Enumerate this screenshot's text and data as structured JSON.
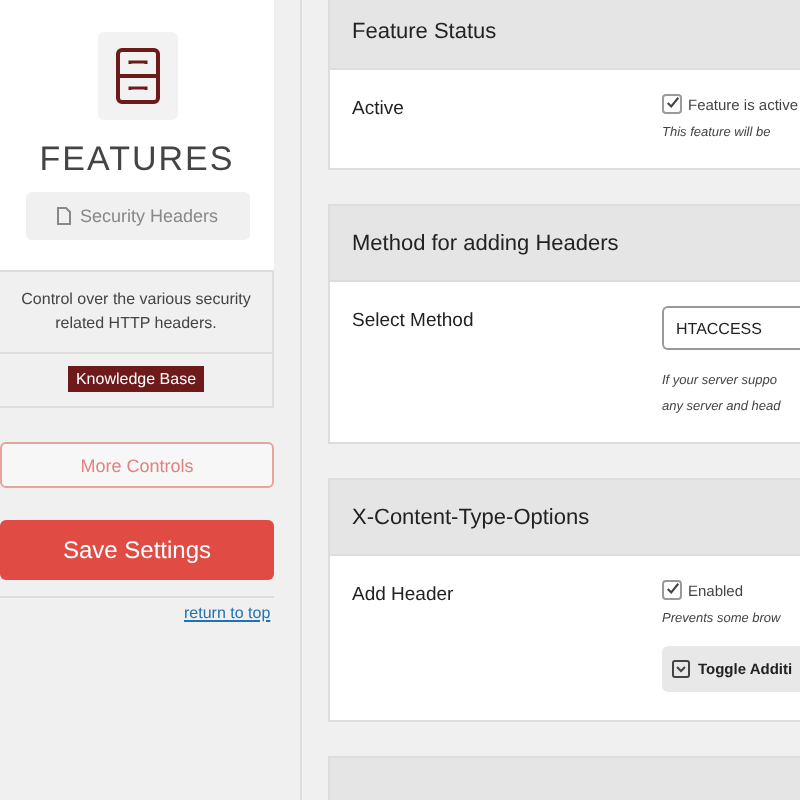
{
  "sidebar": {
    "title": "FEATURES",
    "feature_pill": "Security Headers",
    "description": "Control over the various security related HTTP headers.",
    "kb_badge": "Knowledge Base",
    "more_button": "More Controls",
    "save_button": "Save Settings",
    "top_link": "return to top"
  },
  "cards": [
    {
      "kind": "section",
      "title": "Feature Status",
      "rows": [
        {
          "label": "Active",
          "kind": "checkbox",
          "text": "Feature is active",
          "checked": true,
          "notes": [
            "This feature will be"
          ]
        }
      ]
    },
    {
      "kind": "section",
      "title": "Method for adding Headers",
      "rows": [
        {
          "label": "Select Method",
          "kind": "select",
          "text": "HTACCESS",
          "notes": [
            "If your server suppo",
            "any server and head"
          ]
        }
      ]
    },
    {
      "kind": "section",
      "title": "X-Content-Type-Options",
      "rows": [
        {
          "label": "Add Header",
          "kind": "checkbox",
          "text": "Enabled",
          "checked": true,
          "notes": [
            "Prevents some brow"
          ],
          "toggle": "Toggle Additi"
        }
      ]
    },
    {
      "kind": "cut_off"
    }
  ]
}
